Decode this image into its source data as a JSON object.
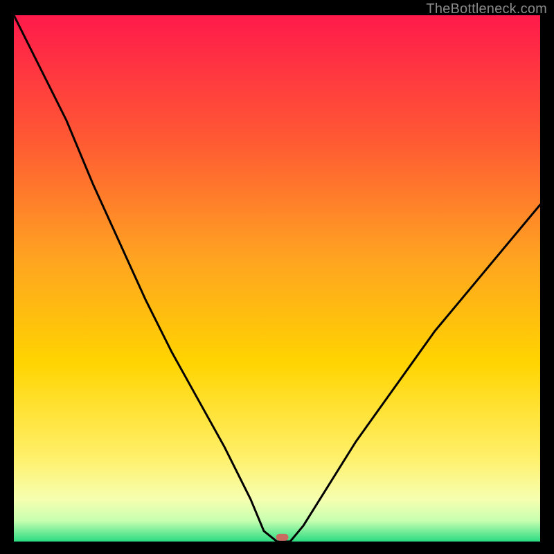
{
  "watermark": "TheBottleneck.com",
  "chart_data": {
    "type": "line",
    "title": "",
    "xlabel": "",
    "ylabel": "",
    "xlim": [
      0,
      100
    ],
    "ylim": [
      0,
      100
    ],
    "series": [
      {
        "name": "bottleneck-curve",
        "x": [
          0,
          5,
          10,
          15,
          20,
          25,
          30,
          35,
          40,
          45,
          47.5,
          50,
          52.5,
          55,
          60,
          65,
          70,
          75,
          80,
          85,
          90,
          95,
          100
        ],
        "y": [
          100,
          90,
          80,
          68,
          57,
          46,
          36,
          27,
          18,
          8,
          2,
          0,
          0,
          3,
          11,
          19,
          26,
          33,
          40,
          46,
          52,
          58,
          64
        ]
      }
    ],
    "flat_segment": {
      "x_start": 47.5,
      "x_end": 52.5,
      "y": 0
    },
    "marker": {
      "x": 51,
      "y": 0.8,
      "color": "#c96a61"
    },
    "background_gradient": {
      "top": "#ff1a4b",
      "mid_upper": "#ff7a2a",
      "mid": "#ffd400",
      "mid_lower": "#fff06a",
      "lower": "#f6ffb0",
      "bottom": "#2cdc82"
    },
    "curve_color": "#000000"
  }
}
